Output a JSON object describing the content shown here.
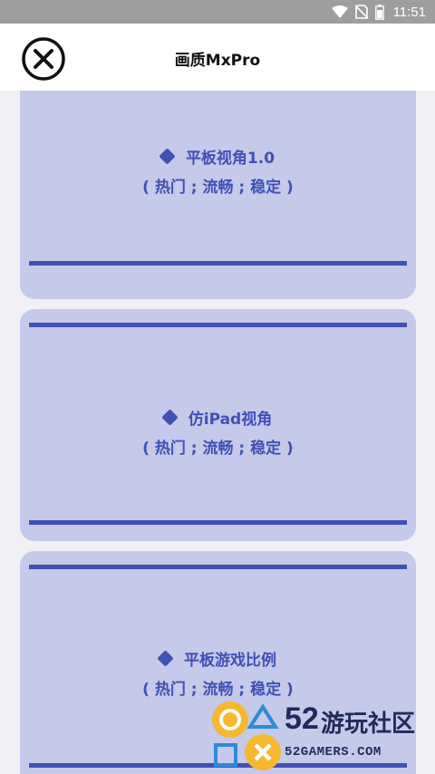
{
  "status_bar": {
    "time": "11:51",
    "icons": [
      "wifi-icon",
      "no-sim-icon",
      "battery-icon"
    ]
  },
  "header": {
    "title": "画质MxPro",
    "close_icon": "close-circle-icon"
  },
  "cards": [
    {
      "title": "平板视角1.0",
      "subtitle": "( 热门 ; 流畅 ; 稳定 )"
    },
    {
      "title": "仿iPad视角",
      "subtitle": "( 热门 ; 流畅 ; 稳定 )"
    },
    {
      "title": "平板游戏比例",
      "subtitle": "( 热门 ; 流畅 ; 稳定 )"
    }
  ],
  "watermark": {
    "number": "52",
    "name": "游玩社区",
    "domain": "52GAMERS.COM"
  },
  "colors": {
    "accent": "#3f51b5",
    "card_bg": "#c5c9ea",
    "page_bg": "#f1f1f5",
    "status_bar": "#9e9e9e"
  }
}
